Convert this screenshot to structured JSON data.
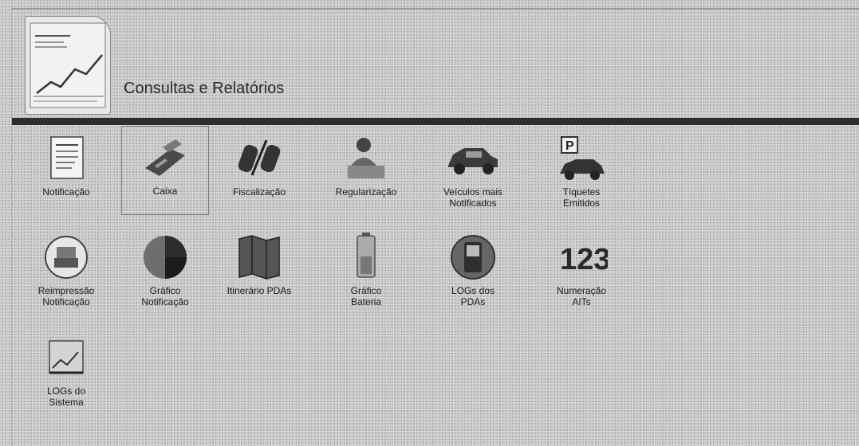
{
  "header": {
    "title": "Consultas e Relatórios"
  },
  "tiles": [
    {
      "label": "Notificação"
    },
    {
      "label": "Caixa"
    },
    {
      "label": "Fiscalização"
    },
    {
      "label": "Regularização"
    },
    {
      "label": "Veículos mais\nNotificados"
    },
    {
      "label": "Tíquetes\nEmitidos"
    },
    {
      "label": "Reimpressão\nNotificação"
    },
    {
      "label": "Gráfico\nNotificação"
    },
    {
      "label": "Itinerário PDAs"
    },
    {
      "label": "Gráfico\nBateria"
    },
    {
      "label": "LOGs dos\nPDAs"
    },
    {
      "label": "Numeração\nAITs"
    },
    {
      "label": "LOGs do\nSistema"
    }
  ],
  "icons": {
    "numbering": "123",
    "parking": "P"
  }
}
